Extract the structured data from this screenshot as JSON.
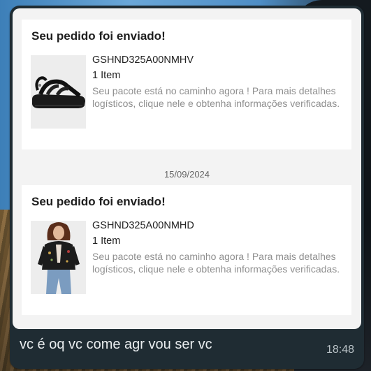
{
  "preview": {
    "orders": [
      {
        "title": "Seu pedido foi enviado!",
        "order_id": "GSHND325A00NMHV",
        "item_count": "1 Item",
        "description": "Seu pacote está no caminho agora ! Para mais detalhes logísticos, clique nele e obtenha informações verificadas.",
        "image": "black-chunky-sandal"
      },
      {
        "title": "Seu pedido foi enviado!",
        "order_id": "GSHND325A00NMHD",
        "item_count": "1 Item",
        "description": "Seu pacote está no caminho agora ! Para mais detalhes logísticos, clique nele e obtenha informações verificadas.",
        "image": "model-black-embroidered-jacket-jeans"
      }
    ],
    "date_separator": "15/09/2024"
  },
  "message": {
    "text": "vc é oq vc come agr vou ser vc",
    "time": "18:48"
  },
  "colors": {
    "bubble": "#1f2c33",
    "preview_bg": "#f3f3f3",
    "card_bg": "#ffffff",
    "message_text": "#e9edef",
    "time_text": "#b9c2c6"
  }
}
